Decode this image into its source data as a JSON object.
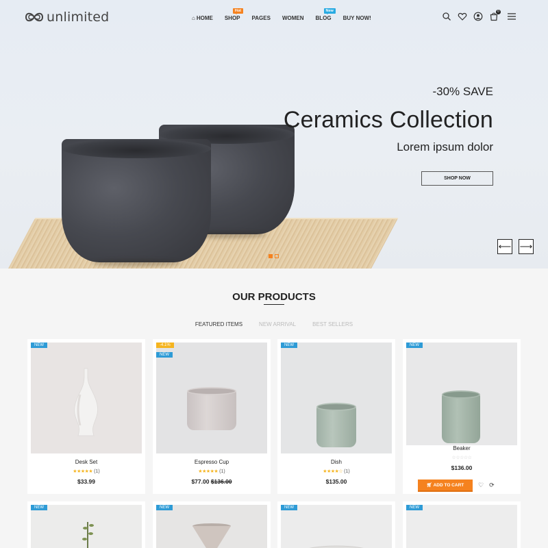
{
  "header": {
    "logo_text": "unlimited",
    "nav": [
      {
        "label": "HOME",
        "badge": ""
      },
      {
        "label": "SHOP",
        "badge": "Hot"
      },
      {
        "label": "PAGES",
        "badge": ""
      },
      {
        "label": "WOMEN",
        "badge": ""
      },
      {
        "label": "BLOG",
        "badge": "New"
      },
      {
        "label": "BUY NOW!",
        "badge": ""
      }
    ],
    "cart_count": "0"
  },
  "hero": {
    "save_text": "-30% SAVE",
    "title": "Ceramics Collection",
    "subtitle": "Lorem ipsum dolor",
    "cta": "SHOP NOW",
    "prev_arrow": "⟵",
    "next_arrow": "⟶"
  },
  "products_section": {
    "title": "OUR PRODUCTS",
    "tabs": [
      "FEATURED ITEMS",
      "NEW ARRIVAL",
      "BEST SELLERS"
    ],
    "active_tab": "FEATURED ITEMS"
  },
  "products": [
    {
      "tags": [
        "NEW"
      ],
      "name": "Desk Set",
      "stars": "★★★★★",
      "reviews": "(1)",
      "price": "$33.99",
      "old_price": ""
    },
    {
      "tags": [
        "-4.1%",
        "NEW"
      ],
      "name": "Espresso Cup",
      "stars": "★★★★★",
      "reviews": "(1)",
      "price": "$77.00",
      "old_price": "$136.00"
    },
    {
      "tags": [
        "NEW"
      ],
      "name": "Dish",
      "stars": "★★★★☆",
      "reviews": "(1)",
      "price": "$135.00",
      "old_price": ""
    },
    {
      "tags": [
        "NEW"
      ],
      "name": "Beaker",
      "stars": "☆☆☆☆☆",
      "reviews": "",
      "price": "$136.00",
      "old_price": "",
      "add_to_cart": "ADD TO CART"
    },
    {
      "tags": [
        "NEW"
      ]
    },
    {
      "tags": [
        "NEW"
      ]
    },
    {
      "tags": [
        "NEW"
      ]
    },
    {
      "tags": [
        "NEW"
      ]
    }
  ],
  "colors": {
    "accent": "#f5821f",
    "tag_new": "#2e9bd6",
    "tag_sale": "#f5b41f",
    "star": "#f5b41f"
  },
  "icons": {
    "search": "search-icon",
    "wishlist": "heart-icon",
    "account": "user-icon",
    "cart": "cart-icon",
    "menu": "hamburger-icon",
    "compare": "refresh-icon"
  }
}
